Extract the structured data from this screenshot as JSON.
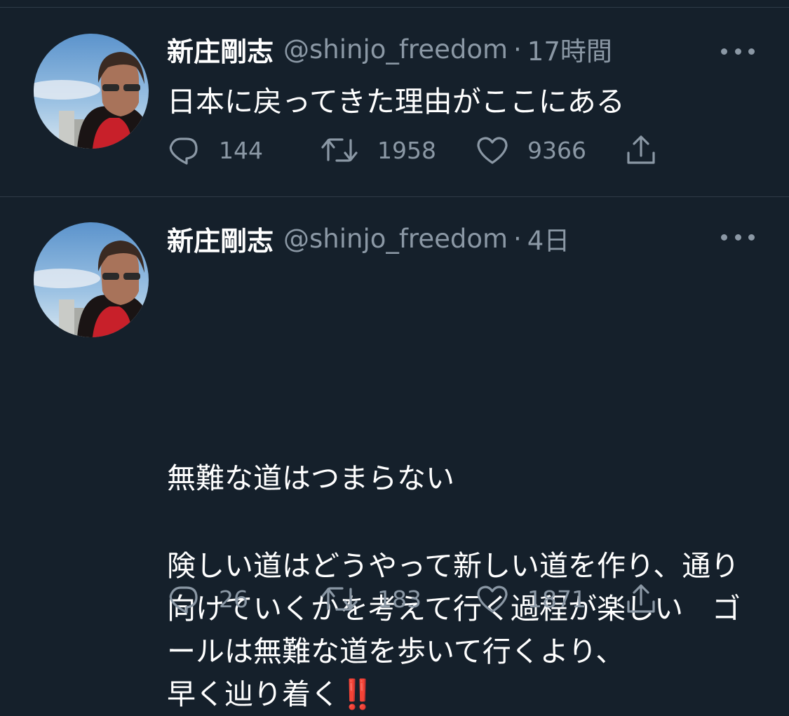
{
  "tweets": [
    {
      "display_name": "新庄剛志",
      "handle": "@shinjo_freedom",
      "separator": "·",
      "time": "17時間",
      "paragraphs": [
        "日本に戻ってきた理由がここにある"
      ],
      "replies": "144",
      "retweets": "1958",
      "likes": "9366"
    },
    {
      "display_name": "新庄剛志",
      "handle": "@shinjo_freedom",
      "separator": "·",
      "time": "4日",
      "paragraphs": [
        "無難な道はつまらない",
        "険しい道はどうやって新しい道を作り、通り向けていくかを考えて行く過程が楽しい　ゴールは無難な道を歩いて行くより、",
        "早く辿り着く",
        "‼️"
      ],
      "replies": "26",
      "retweets": "183",
      "likes": "1871"
    }
  ],
  "icons": {
    "reply": "reply-icon",
    "retweet": "retweet-icon",
    "like": "heart-icon",
    "share": "share-icon",
    "more": "more-icon"
  },
  "colors": {
    "background": "#15202b",
    "secondary_text": "#8b98a5",
    "emoji_red": "#e0245e"
  }
}
